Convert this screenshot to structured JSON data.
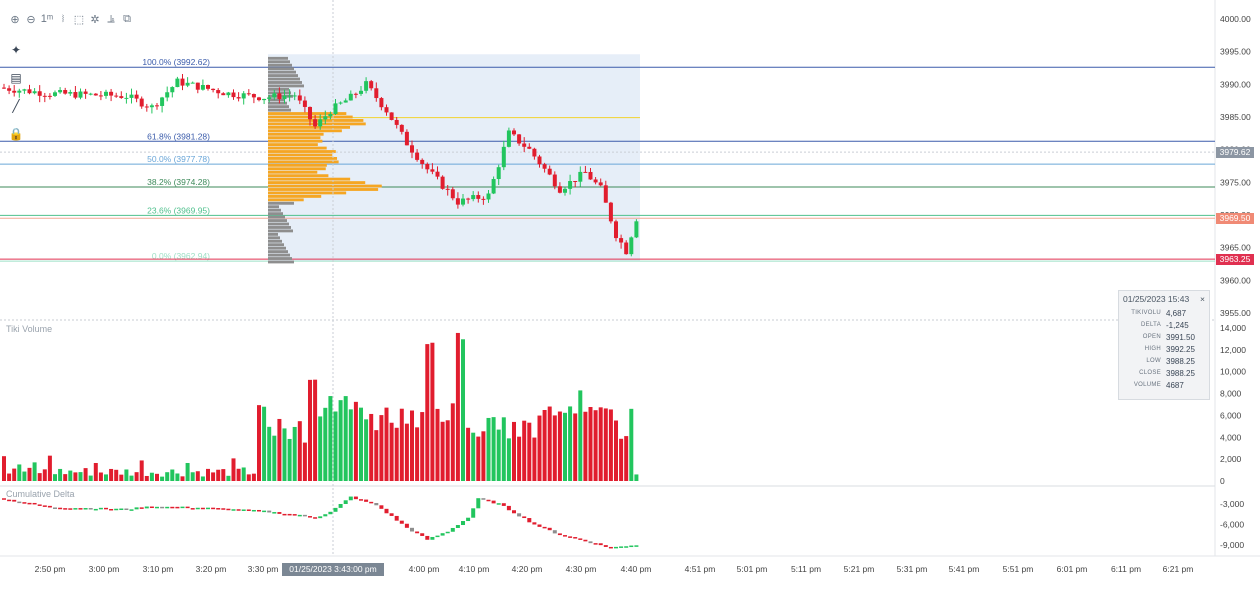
{
  "toolbar": {
    "items": [
      {
        "name": "zoom-in-icon",
        "glyph": "⊕"
      },
      {
        "name": "zoom-out-icon",
        "glyph": "⊖"
      },
      {
        "name": "interval-icon",
        "glyph": "1ᵐ"
      },
      {
        "name": "candle-type-icon",
        "glyph": "⧘"
      },
      {
        "name": "select-region-icon",
        "glyph": "⬚"
      },
      {
        "name": "settings-icon",
        "glyph": "✲"
      },
      {
        "name": "indicators-icon",
        "glyph": "⫡"
      },
      {
        "name": "layout-icon",
        "glyph": "⧉"
      }
    ]
  },
  "sidebar": {
    "items": [
      {
        "name": "crosshair-icon",
        "glyph": "✦"
      },
      {
        "name": "calculator-icon",
        "glyph": "▤"
      },
      {
        "name": "line-draw-icon",
        "glyph": "╱"
      },
      {
        "name": "lock-icon",
        "glyph": "🔒"
      }
    ]
  },
  "price_axis": {
    "ticks": [
      "4000.00",
      "3995.00",
      "3990.00",
      "3985.00",
      "3980.00",
      "3975.00",
      "3970.00",
      "3965.00",
      "3960.00",
      "3955.00"
    ],
    "ymax": 4000,
    "ymin": 3955,
    "tags": [
      {
        "label": "3979.62",
        "value": 3979.62,
        "color": "#8c96a3"
      },
      {
        "label": "3969.50",
        "value": 3969.5,
        "color": "#f08a75"
      },
      {
        "label": "3963.25",
        "value": 3963.25,
        "color": "#e03050"
      }
    ]
  },
  "fib_levels": [
    {
      "label": "100.0% (3992.62)",
      "value": 3992.62,
      "color": "#3b5cab"
    },
    {
      "label": "61.8% (3981.28)",
      "value": 3981.28,
      "color": "#3b5cab"
    },
    {
      "label": "50.0% (3977.78)",
      "value": 3977.78,
      "color": "#6aa6d8"
    },
    {
      "label": "38.2% (3974.28)",
      "value": 3974.28,
      "color": "#3d8a5a"
    },
    {
      "label": "23.6% (3969.95)",
      "value": 3969.95,
      "color": "#4fc08d"
    },
    {
      "label": "0.0% (3962.94)",
      "value": 3962.94,
      "color": "#9ee0c6"
    }
  ],
  "volume_panel": {
    "title": "Tiki Volume",
    "ticks": [
      "14,000",
      "12,000",
      "10,000",
      "8,000",
      "6,000",
      "4,000",
      "2,000",
      "0"
    ]
  },
  "delta_panel": {
    "title": "Cumulative Delta",
    "ticks": [
      "-3,000",
      "-6,000",
      "-9,000"
    ]
  },
  "time_axis": {
    "labels": [
      "2:50 pm",
      "3:00 pm",
      "3:10 pm",
      "3:20 pm",
      "3:30 pm",
      "4:00 pm",
      "4:10 pm",
      "4:20 pm",
      "4:30 pm",
      "4:40 pm",
      "4:51 pm",
      "5:01 pm",
      "5:11 pm",
      "5:21 pm",
      "5:31 pm",
      "5:41 pm",
      "5:51 pm",
      "6:01 pm",
      "6:11 pm",
      "6:21 pm"
    ],
    "crosshair_label": "01/25/2023 3:43:00 pm"
  },
  "tooltip": {
    "date": "01/25/2023 15:43",
    "close_glyph": "×",
    "rows": [
      {
        "k": "TIKIVOLU",
        "v": "4,687"
      },
      {
        "k": "DELTA",
        "v": "-1,245"
      },
      {
        "k": "OPEN",
        "v": "3991.50"
      },
      {
        "k": "HIGH",
        "v": "3992.25"
      },
      {
        "k": "LOW",
        "v": "3988.25"
      },
      {
        "k": "CLOSE",
        "v": "3988.25"
      },
      {
        "k": "VOLUME",
        "v": "4687"
      }
    ]
  },
  "colors": {
    "up": "#22c55e",
    "down": "#e11d2e",
    "profile": "#f5a623",
    "profile_gray": "#8e8e8e",
    "fib_box": "#e6eef8"
  }
}
